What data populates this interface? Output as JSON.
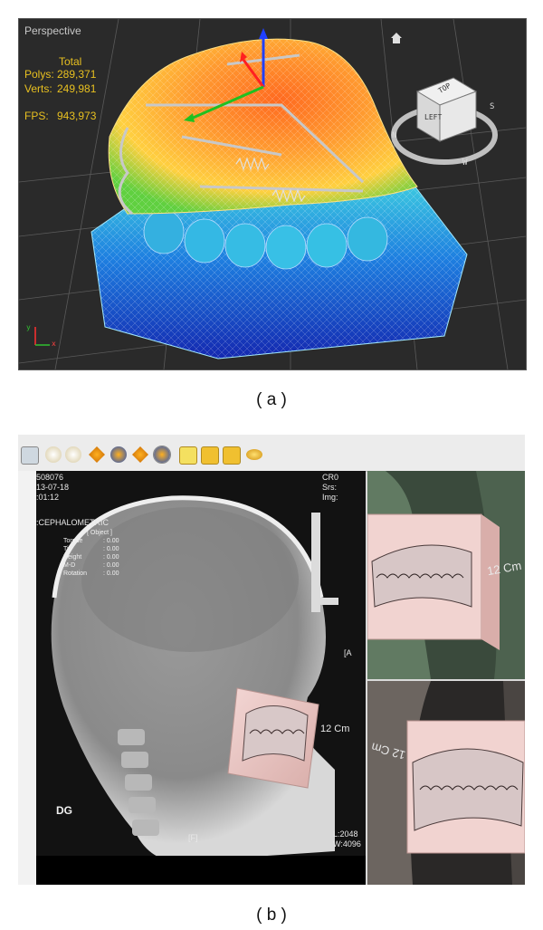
{
  "panel_a": {
    "view_label": "Perspective",
    "stats": {
      "total_label": "Total",
      "polys_label": "Polys:",
      "polys_value": "289,371",
      "verts_label": "Verts:",
      "verts_value": "249,981",
      "fps_label": "FPS:",
      "fps_value": "943,973"
    },
    "viewcube": {
      "top": "TOP",
      "left": "LEFT",
      "compass": [
        "N",
        "W",
        "S"
      ]
    },
    "axis_labels": [
      "y",
      "x"
    ],
    "caption": "( a )"
  },
  "panel_b": {
    "header_lines": [
      "508076",
      "13-07-18",
      ":01:12"
    ],
    "right_header": [
      "CR0",
      "Srs:",
      "Img:"
    ],
    "mode_label": ":CEPHALOMETRIC",
    "object_panel": {
      "title": "[ Object ]",
      "rows": [
        {
          "label": "Torque",
          "value": ": 0.00"
        },
        {
          "label": "Tip",
          "value": ": 0.00"
        },
        {
          "label": "Height",
          "value": ": 0.00"
        },
        {
          "label": "M-D",
          "value": ": 0.00"
        },
        {
          "label": "Rotation",
          "value": ": 0.00"
        }
      ]
    },
    "marker_a": "[A",
    "marker_f": "[F]",
    "initials": "DG",
    "level": "L:2048",
    "width": "W:4096",
    "scale_label": "12 Cm",
    "thumb1_scale": "12 Cm",
    "thumb2_scale": "12 Cm",
    "caption": "( b )"
  },
  "colors": {
    "stats_text": "#e8c020",
    "viewport_bg": "#2a2a2a",
    "model_pink": "#e8c4c0",
    "xray_bg": "#121212"
  }
}
